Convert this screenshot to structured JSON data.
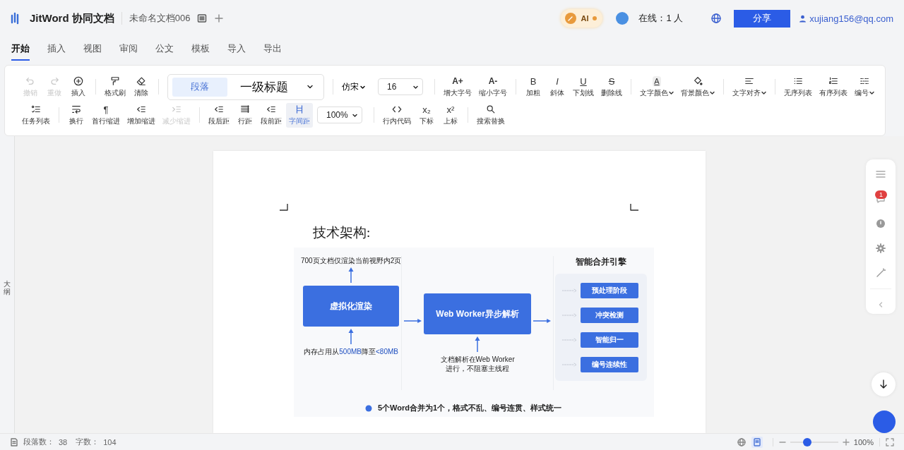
{
  "header": {
    "app_title": "JitWord 协同文档",
    "document_name": "未命名文档006",
    "ai_label": "AI",
    "online": "在线：1 人",
    "share": "分享",
    "user_email": "xujiang156@qq.com"
  },
  "tabs": [
    {
      "label": "开始",
      "selected": true
    },
    {
      "label": "插入",
      "selected": false
    },
    {
      "label": "视图",
      "selected": false
    },
    {
      "label": "审阅",
      "selected": false
    },
    {
      "label": "公文",
      "selected": false
    },
    {
      "label": "模板",
      "selected": false
    },
    {
      "label": "导入",
      "selected": false
    },
    {
      "label": "导出",
      "selected": false
    }
  ],
  "toolbar": {
    "rows": [
      [
        [
          {
            "kind": "button",
            "label": "撤销",
            "disabled": true,
            "selected": false,
            "dropdown": false
          },
          {
            "kind": "button",
            "label": "重做",
            "disabled": true,
            "selected": false,
            "dropdown": false
          },
          {
            "kind": "button",
            "label": "插入",
            "disabled": false,
            "selected": false,
            "dropdown": false
          }
        ],
        [
          {
            "kind": "button",
            "label": "格式刷",
            "disabled": false,
            "selected": false,
            "dropdown": false
          },
          {
            "kind": "button",
            "label": "清除",
            "disabled": false,
            "selected": false,
            "dropdown": false
          }
        ],
        [
          {
            "kind": "style-picker",
            "options": [
              {
                "label": "段落",
                "selected": true
              },
              {
                "label": "一级标题",
                "selected": false
              }
            ]
          }
        ],
        [
          {
            "kind": "select",
            "value": "仿宋"
          },
          {
            "kind": "field",
            "value": "16"
          }
        ],
        [
          {
            "kind": "glyph-button",
            "glyph": "A+",
            "label": "增大字号",
            "disabled": false,
            "selected": false,
            "dropdown": false
          },
          {
            "kind": "glyph-button",
            "glyph": "A-",
            "label": "缩小字号",
            "disabled": false,
            "selected": false,
            "dropdown": false
          }
        ],
        [
          {
            "kind": "glyph-button",
            "glyph": "B",
            "label": "加粗",
            "disabled": false,
            "selected": false,
            "dropdown": false
          },
          {
            "kind": "glyph-button",
            "glyph": "I",
            "label": "斜体",
            "disabled": false,
            "selected": false,
            "dropdown": false
          },
          {
            "kind": "glyph-button",
            "glyph": "U",
            "label": "下划线",
            "disabled": false,
            "selected": false,
            "dropdown": false
          },
          {
            "kind": "glyph-button",
            "glyph": "S",
            "label": "删除线",
            "disabled": false,
            "selected": false,
            "dropdown": false
          }
        ],
        [
          {
            "kind": "glyph-button",
            "glyph": "A",
            "label": "文字颜色",
            "disabled": false,
            "selected": false,
            "dropdown": true
          },
          {
            "kind": "button",
            "label": "背景颜色",
            "disabled": false,
            "selected": false,
            "dropdown": true
          }
        ],
        [
          {
            "kind": "button",
            "label": "文字对齐",
            "disabled": false,
            "selected": false,
            "dropdown": true
          }
        ],
        [
          {
            "kind": "button",
            "label": "无序列表",
            "disabled": false,
            "selected": false,
            "dropdown": false
          },
          {
            "kind": "button",
            "label": "有序列表",
            "disabled": false,
            "selected": false,
            "dropdown": false
          },
          {
            "kind": "button",
            "label": "编号",
            "disabled": false,
            "selected": false,
            "dropdown": true
          }
        ]
      ],
      [
        [
          {
            "kind": "button",
            "label": "任务列表",
            "disabled": false,
            "selected": false,
            "dropdown": false
          }
        ],
        [
          {
            "kind": "button",
            "label": "换行",
            "disabled": false,
            "selected": false,
            "dropdown": false
          },
          {
            "kind": "glyph-button",
            "glyph": "¶",
            "label": "首行缩进",
            "disabled": false,
            "selected": false,
            "dropdown": false
          },
          {
            "kind": "button",
            "label": "增加缩进",
            "disabled": false,
            "selected": false,
            "dropdown": false
          },
          {
            "kind": "button",
            "label": "减少缩进",
            "disabled": true,
            "selected": false,
            "dropdown": false
          }
        ],
        [
          {
            "kind": "button",
            "label": "段后距",
            "disabled": false,
            "selected": false,
            "dropdown": false
          },
          {
            "kind": "button",
            "label": "行距",
            "disabled": false,
            "selected": false,
            "dropdown": false
          },
          {
            "kind": "button",
            "label": "段前距",
            "disabled": false,
            "selected": false,
            "dropdown": false
          },
          {
            "kind": "button",
            "label": "字间距",
            "disabled": false,
            "selected": true,
            "dropdown": false
          },
          {
            "kind": "field",
            "value": "100%"
          }
        ],
        [
          {
            "kind": "button",
            "label": "行内代码",
            "disabled": false,
            "selected": false,
            "dropdown": false
          },
          {
            "kind": "glyph-button",
            "glyph": "x₂",
            "label": "下标",
            "disabled": false,
            "selected": false,
            "dropdown": false
          },
          {
            "kind": "glyph-button",
            "glyph": "x²",
            "label": "上标",
            "disabled": false,
            "selected": false,
            "dropdown": false
          }
        ],
        [
          {
            "kind": "button",
            "label": "搜索替换",
            "disabled": false,
            "selected": false,
            "dropdown": false
          }
        ]
      ]
    ]
  },
  "outline_label": "大纲",
  "document": {
    "heading": "技术架构:",
    "diagram": {
      "render_note": "700页文档仅渲染当前视野内2页",
      "render_box": "虚拟化渲染",
      "memory_note": [
        {
          "text": "内存占用从",
          "highlight": false
        },
        {
          "text": "500MB",
          "highlight": true
        },
        {
          "text": "降至",
          "highlight": false
        },
        {
          "text": "<80MB",
          "highlight": true
        }
      ],
      "worker_box": "Web Worker异步解析",
      "worker_note": [
        "文档解析在Web Worker",
        "进行，不阻塞主线程"
      ],
      "engine_title": "智能合并引擎",
      "stages": [
        "预处理阶段",
        "冲突检测",
        "智能归一",
        "编号连续性"
      ],
      "summary": "5个Word合并为1个，格式不乱、编号连贯、样式统一"
    }
  },
  "side_panel": {
    "comment_badge": "1"
  },
  "status_bar": {
    "paragraphs_label": "段落数：",
    "paragraphs": "38",
    "words_label": "字数：",
    "words": "104",
    "view_modes": [
      {
        "selected": false
      },
      {
        "selected": true
      }
    ],
    "zoom_slider": {
      "level": 0.35
    },
    "zoom": "100%"
  }
}
